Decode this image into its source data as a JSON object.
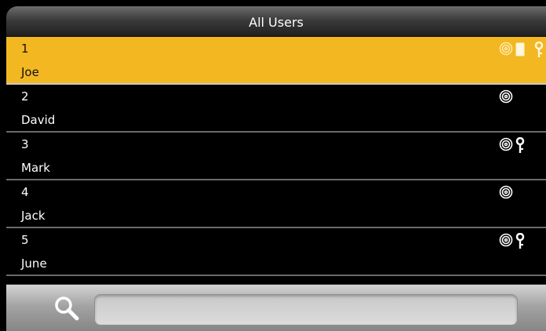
{
  "header": {
    "title": "All Users"
  },
  "users": [
    {
      "id": "1",
      "name": "Joe",
      "selected": true,
      "icons": [
        "fingerprint-icon",
        "card-icon",
        "key-icon"
      ]
    },
    {
      "id": "2",
      "name": "David",
      "selected": false,
      "icons": [
        "fingerprint-icon"
      ]
    },
    {
      "id": "3",
      "name": "Mark",
      "selected": false,
      "icons": [
        "fingerprint-icon",
        "key-icon"
      ]
    },
    {
      "id": "4",
      "name": "Jack",
      "selected": false,
      "icons": [
        "fingerprint-icon"
      ]
    },
    {
      "id": "5",
      "name": "June",
      "selected": false,
      "icons": [
        "fingerprint-icon",
        "key-icon"
      ]
    }
  ],
  "footer": {
    "search_icon": "search-icon",
    "search_placeholder": ""
  },
  "colors": {
    "selected_row": "#f3b721",
    "background": "#000000",
    "text": "#ffffff"
  }
}
